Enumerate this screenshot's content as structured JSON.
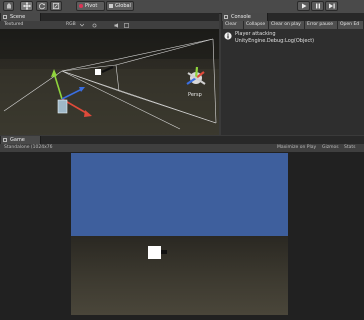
{
  "toolbar": {
    "pivot_label": "Pivot",
    "global_label": "Global",
    "tools": [
      "hand-tool",
      "move-tool",
      "rotate-tool",
      "scale-tool"
    ],
    "play_controls": [
      "play",
      "pause",
      "step"
    ]
  },
  "scene": {
    "tab_label": "Scene",
    "shading_mode": "Textured",
    "render_mode": "RGB",
    "gizmo_label": "Persp"
  },
  "console": {
    "tab_label": "Console",
    "buttons": [
      "Clear",
      "Collapse",
      "Clear on play",
      "Error pause",
      "Open Ed"
    ],
    "message_line1": "Player attacking",
    "message_line2": "UnityEngine.Debug:Log(Object)"
  },
  "game": {
    "tab_label": "Game",
    "resolution": "Standalone (1024x76",
    "maximize_label": "Maximize on Play",
    "gizmos_label": "Gizmos",
    "stats_label": "Stats"
  },
  "colors": {
    "sky": "#3e5f9d",
    "player_cube": "#ffffff",
    "gizmo_x": "#e04a3a",
    "gizmo_y": "#8fd43c",
    "gizmo_z": "#3a6ee0"
  }
}
